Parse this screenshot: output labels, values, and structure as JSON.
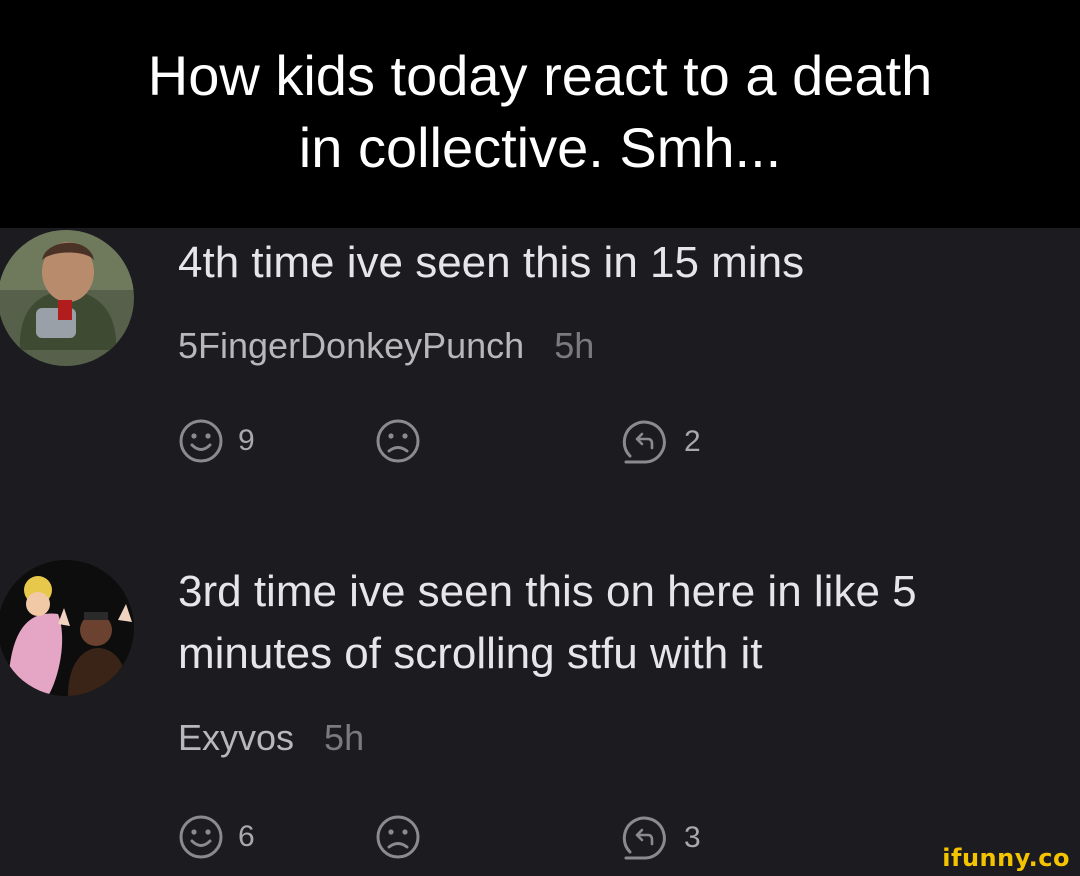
{
  "header": {
    "title": "How kids today react to a death\nin collective. Smh..."
  },
  "comments": [
    {
      "text": "4th time ive seen this in 15 mins",
      "username": "5FingerDonkeyPunch",
      "time": "5h",
      "smile_count": "9",
      "replies_count": "2"
    },
    {
      "text": "3rd time ive seen this on here in like 5\nminutes of scrolling stfu with it",
      "username": "Exyvos",
      "time": "5h",
      "smile_count": "6",
      "replies_count": "3"
    }
  ],
  "icons": {
    "smile": "smile-icon",
    "frown": "frown-icon",
    "reply": "reply-icon"
  },
  "colors": {
    "background": "#1b1b20",
    "header": "#000000",
    "watermark": "#f5c400"
  },
  "watermark": "ifunny.co"
}
